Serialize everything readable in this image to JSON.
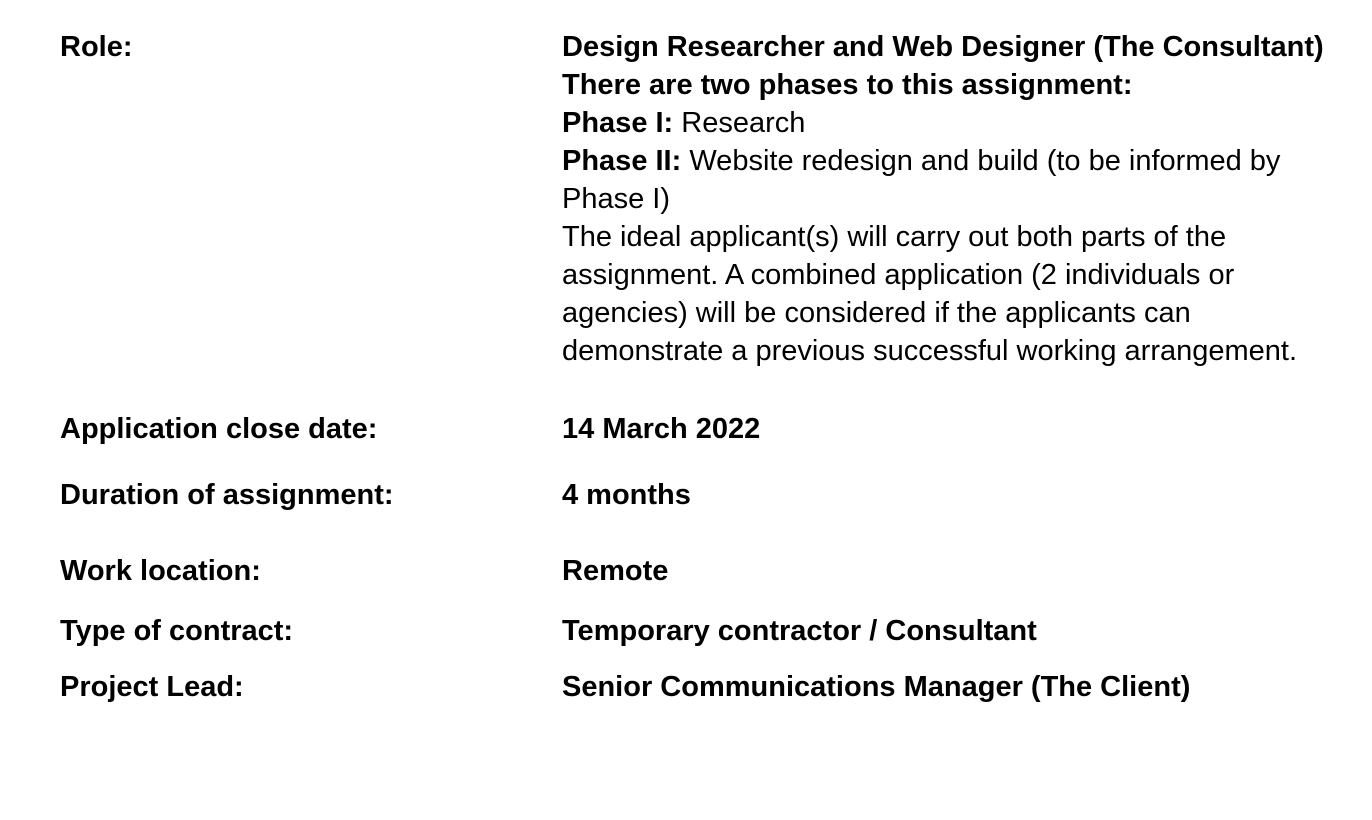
{
  "rows": {
    "role": {
      "label": "Role:",
      "title": "Design Researcher and Web Designer (The Consultant)",
      "phases_heading": "There are two phases to this assignment:",
      "phase1_label": "Phase I:",
      "phase1_text": " Research",
      "phase2_label": "Phase II:",
      "phase2_text": " Website redesign and build (to be informed by Phase I)",
      "note": "The ideal applicant(s) will carry out both parts of the assignment. A combined application (2 individuals or agencies) will be considered if the applicants can demonstrate a previous successful working arrangement."
    },
    "close_date": {
      "label": "Application close date:",
      "value": "14 March 2022"
    },
    "duration": {
      "label": "Duration of assignment:",
      "value": "4 months"
    },
    "location": {
      "label": "Work location:",
      "value": "Remote"
    },
    "contract": {
      "label": "Type of contract:",
      "value": "Temporary contractor / Consultant"
    },
    "lead": {
      "label": "Project Lead:",
      "value": "Senior Communications Manager (The Client)"
    }
  }
}
